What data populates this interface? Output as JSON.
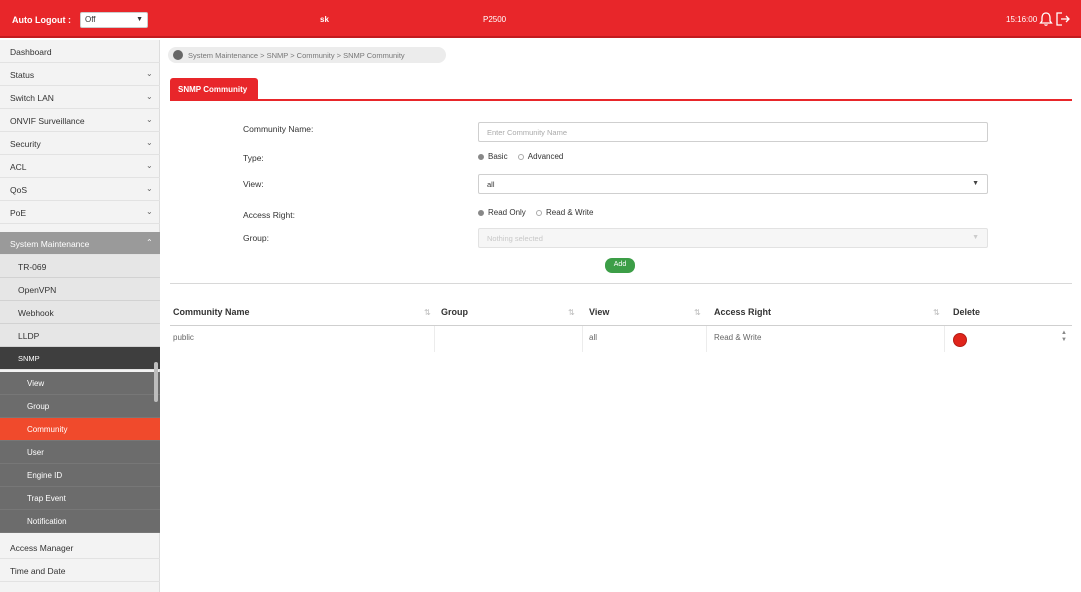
{
  "topbar": {
    "auto_logout_label": "Auto Logout :",
    "auto_logout_value": "Off",
    "user": "sk",
    "model": "P2500",
    "time": "15:16:00",
    "bell_icon": "bell-icon",
    "logout_icon": "logout-icon",
    "brand_color": "#e8262a"
  },
  "sidebar": {
    "items": [
      {
        "label": "Dashboard",
        "arrow": ""
      },
      {
        "label": "Status",
        "arrow": "⌄"
      },
      {
        "label": "Switch LAN",
        "arrow": "⌄"
      },
      {
        "label": "ONVIF Surveillance",
        "arrow": "⌄"
      },
      {
        "label": "Security",
        "arrow": "⌄"
      },
      {
        "label": "ACL",
        "arrow": "⌄"
      },
      {
        "label": "QoS",
        "arrow": "⌄"
      },
      {
        "label": "PoE",
        "arrow": "⌄"
      },
      {
        "label": "System Maintenance",
        "arrow": "⌃"
      },
      {
        "label": "TR-069"
      },
      {
        "label": "OpenVPN"
      },
      {
        "label": "Webhook"
      },
      {
        "label": "LLDP"
      },
      {
        "label": "SNMP"
      },
      {
        "label": "View"
      },
      {
        "label": "Group"
      },
      {
        "label": "Community"
      },
      {
        "label": "User"
      },
      {
        "label": "Engine ID"
      },
      {
        "label": "Trap Event"
      },
      {
        "label": "Notification"
      },
      {
        "label": "Access Manager"
      },
      {
        "label": "Time and Date"
      }
    ],
    "active_color": "#f04a2c"
  },
  "breadcrumb": "System Maintenance > SNMP > Community > SNMP Community",
  "tab": "SNMP Community",
  "form": {
    "community_name_label": "Community Name:",
    "community_name_placeholder": "Enter Community Name",
    "type_label": "Type:",
    "type_options": [
      "Basic",
      "Advanced"
    ],
    "type_selected": "Basic",
    "view_label": "View:",
    "view_value": "all",
    "access_right_label": "Access Right:",
    "access_right_options": [
      "Read Only",
      "Read & Write"
    ],
    "access_right_selected": "Read Only",
    "group_label": "Group:",
    "group_placeholder": "Nothing selected",
    "add_button": "Add",
    "add_color": "#3c9e47"
  },
  "table": {
    "columns": [
      "Community Name",
      "Group",
      "View",
      "Access Right",
      "Delete"
    ],
    "rows": [
      {
        "community_name": "public",
        "group": "",
        "view": "all",
        "access_right": "Read & Write"
      }
    ],
    "delete_color": "#e0251b"
  }
}
